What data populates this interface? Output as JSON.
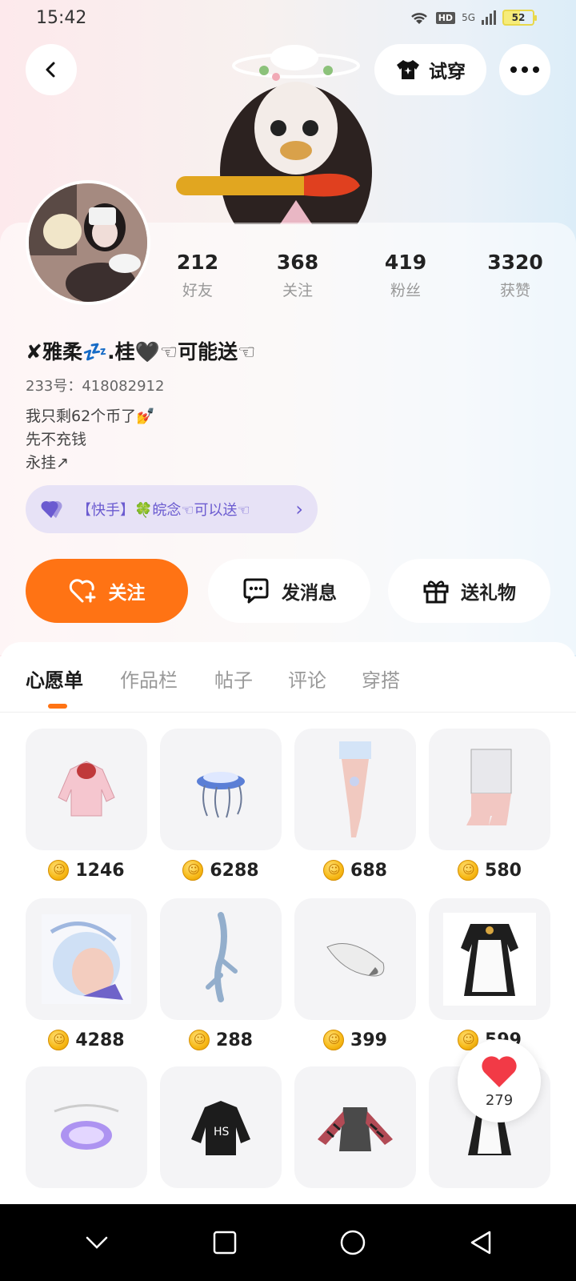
{
  "status_bar": {
    "time": "15:42",
    "network": "5G",
    "hd": "HD",
    "battery": "52"
  },
  "header": {
    "back_icon": "chevron-left-icon",
    "try_on_label": "试穿",
    "more_icon": "more-dots-icon"
  },
  "profile": {
    "stats": [
      {
        "value": "212",
        "label": "好友"
      },
      {
        "value": "368",
        "label": "关注"
      },
      {
        "value": "419",
        "label": "粉丝"
      },
      {
        "value": "3320",
        "label": "获赞"
      }
    ],
    "username": "✘雅柔💤.桂🖤☜可能送☜",
    "uid": "233号：418082912",
    "bio": [
      "我只剩62个币了💅",
      "先不充钱",
      "永挂↗"
    ],
    "badge_text": "【快手】🍀皖念☜可以送☜"
  },
  "actions": {
    "follow": "关注",
    "message": "发消息",
    "gift": "送礼物"
  },
  "tabs": [
    "心愿单",
    "作品栏",
    "帖子",
    "评论",
    "穿搭"
  ],
  "active_tab": "心愿单",
  "wishlist": [
    {
      "price": "1246",
      "icon": "pink-hoodie"
    },
    {
      "price": "6288",
      "icon": "jellyfish-accessory"
    },
    {
      "price": "688",
      "icon": "single-stocking"
    },
    {
      "price": "580",
      "icon": "lace-socks"
    },
    {
      "price": "4288",
      "icon": "crystal-hair"
    },
    {
      "price": "288",
      "icon": "antler-accessory"
    },
    {
      "price": "399",
      "icon": "fur-tail"
    },
    {
      "price": "599",
      "icon": "maid-dress"
    },
    {
      "price": "",
      "icon": "halo-crown"
    },
    {
      "price": "",
      "icon": "black-hoodie"
    },
    {
      "price": "",
      "icon": "striped-top"
    },
    {
      "price": "",
      "icon": "maid-apron"
    }
  ],
  "like_float": {
    "count": "279"
  },
  "colors": {
    "accent": "#ff7314",
    "badge_bg": "#e7e2f6",
    "badge_text": "#6b5bd0"
  }
}
